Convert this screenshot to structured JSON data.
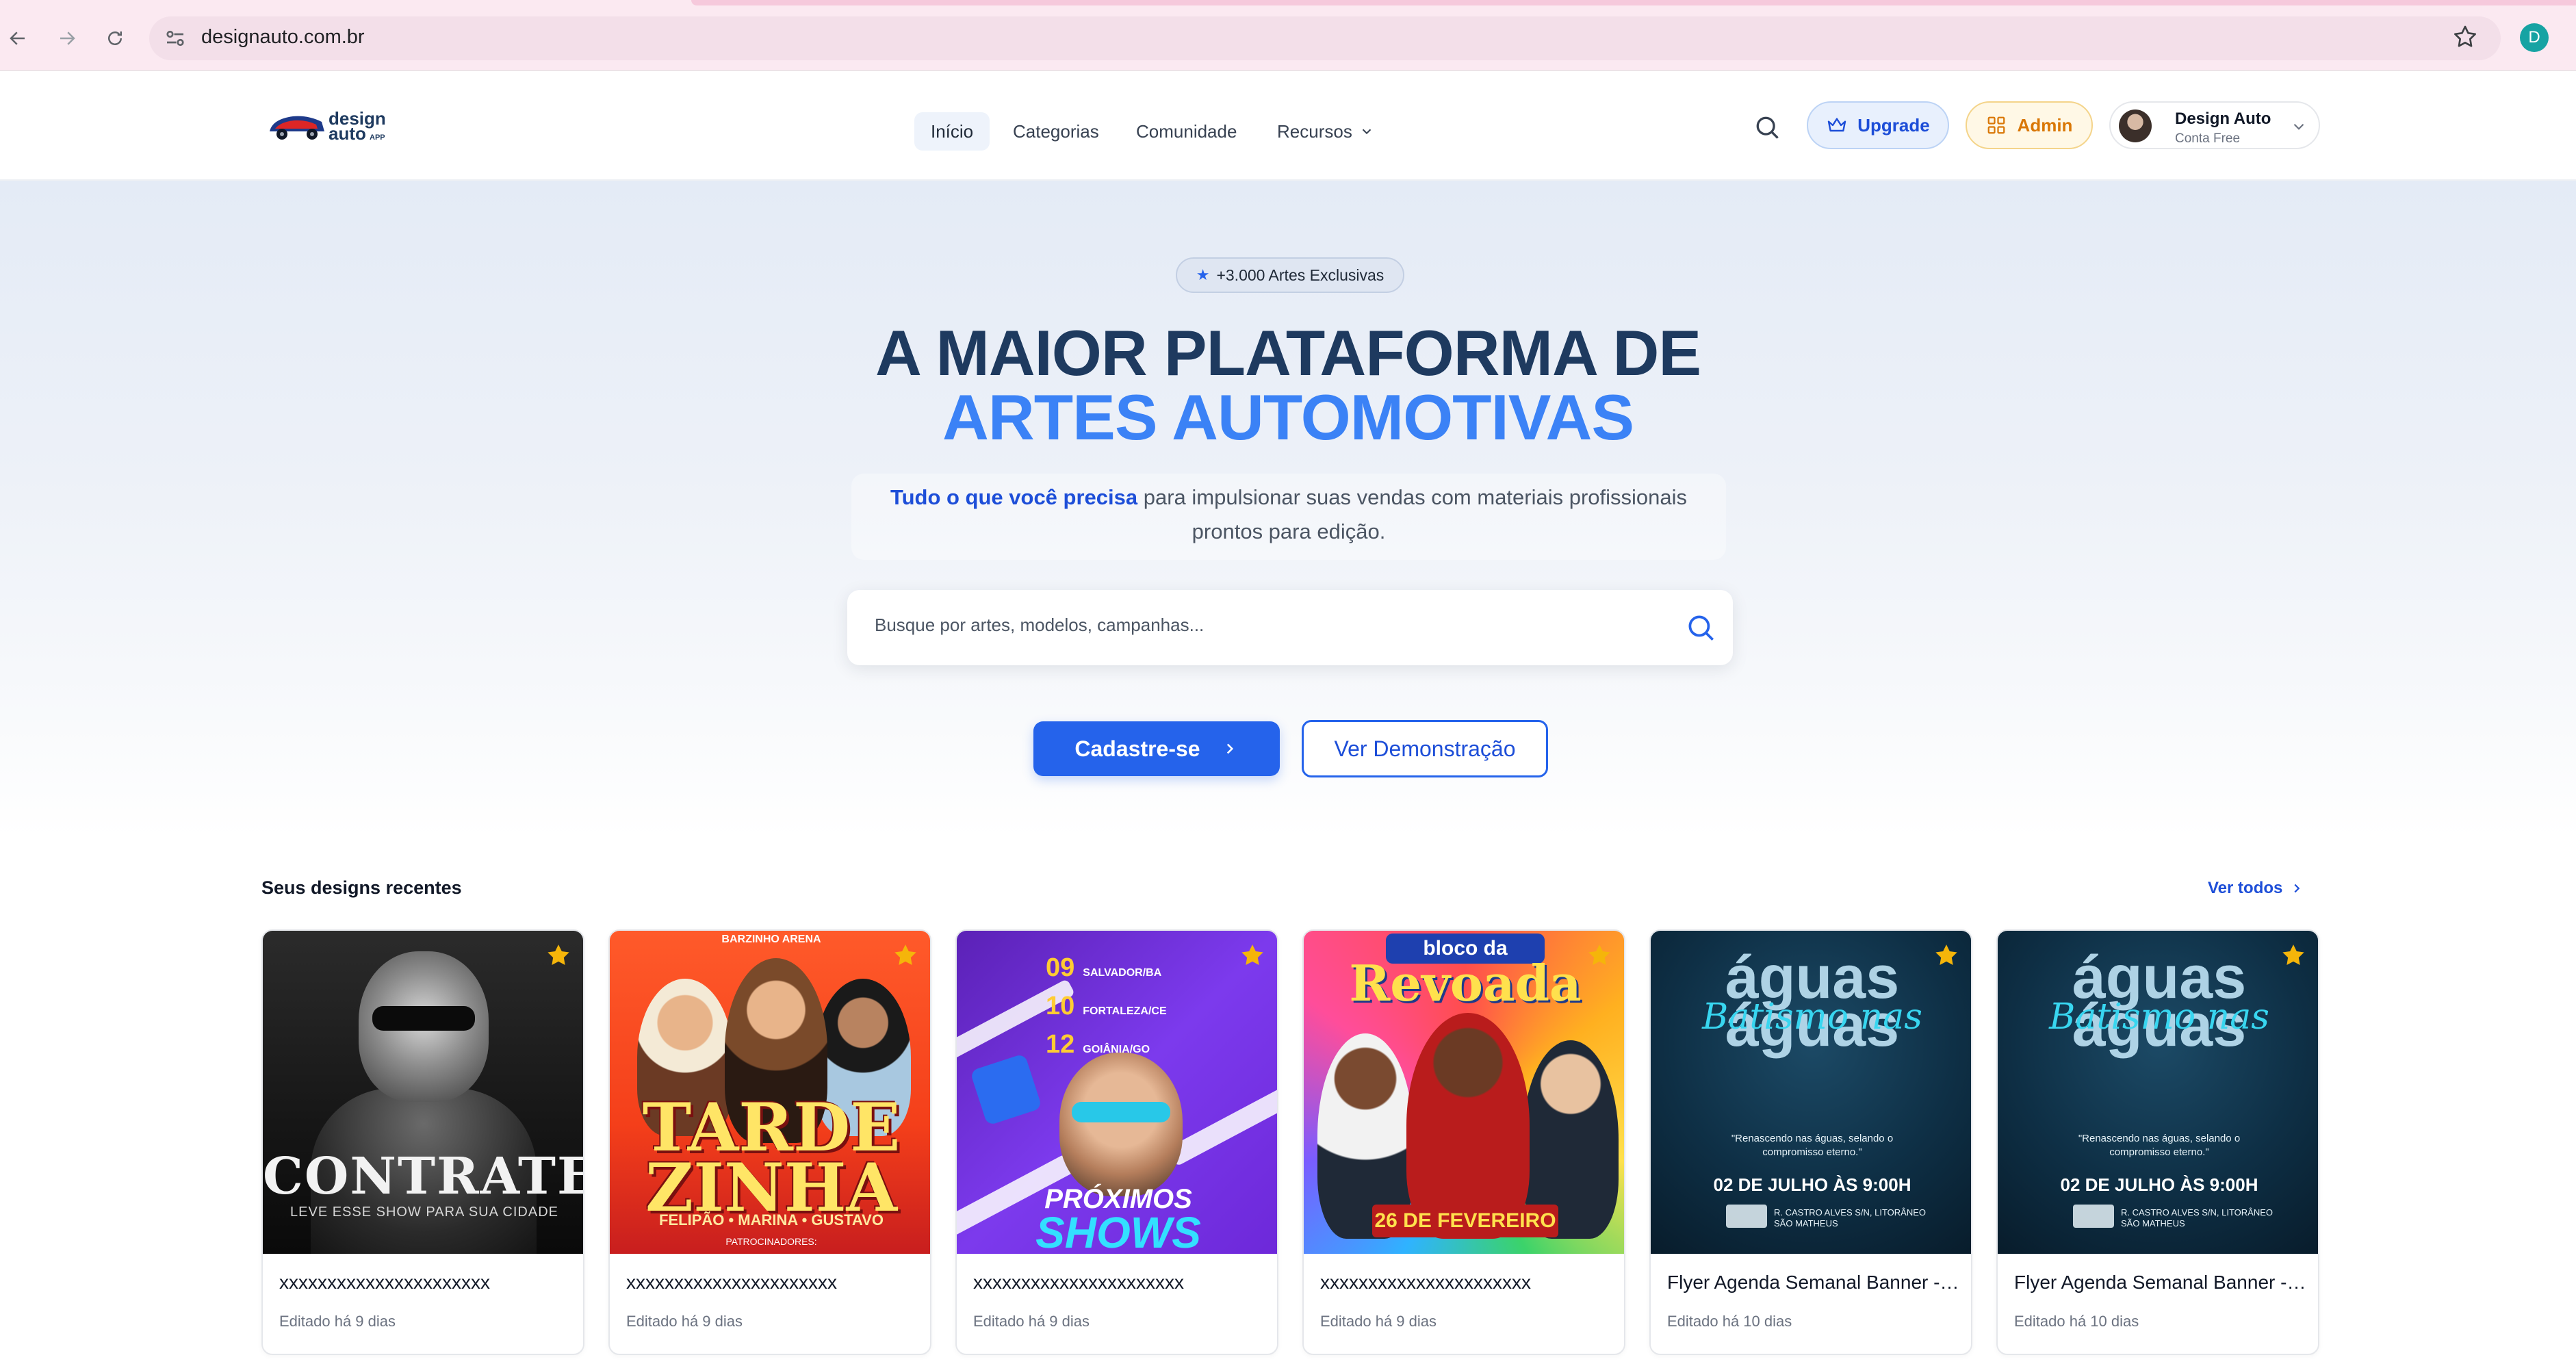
{
  "browser": {
    "url": "designauto.com.br",
    "profile_initial": "D"
  },
  "header": {
    "logo_text": "design auto APP",
    "nav": [
      "Início",
      "Categorias",
      "Comunidade",
      "Recursos"
    ],
    "upgrade_label": "Upgrade",
    "admin_label": "Admin",
    "account": {
      "name": "Design Auto",
      "plan": "Conta Free"
    }
  },
  "hero": {
    "badge": "+3.000 Artes Exclusivas",
    "title_line1": "A MAIOR PLATAFORMA DE",
    "title_line2": "ARTES AUTOMOTIVAS",
    "subtitle_highlight": "Tudo o que você precisa",
    "subtitle_rest": " para impulsionar suas vendas com materiais profissionais",
    "subtitle_line2": "prontos para edição.",
    "search_placeholder": "Busque por artes, modelos, campanhas...",
    "cta_primary": "Cadastre-se",
    "cta_secondary": "Ver Demonstração"
  },
  "recent": {
    "title": "Seus designs recentes",
    "view_all": "Ver todos",
    "cards": [
      {
        "title": "xxxxxxxxxxxxxxxxxxxxxx",
        "edited": "Editado há 9 dias",
        "art_text": "CONTRATE",
        "art_sub": "LEVE ESSE SHOW PARA SUA CIDADE"
      },
      {
        "title": "xxxxxxxxxxxxxxxxxxxxxx",
        "edited": "Editado há 9 dias",
        "art_top": "BARZINHO ARENA",
        "art_text": "TARDE ZINHA",
        "art_sub": "FELIPÃO • MARINA • GUSTAVO",
        "art_foot": "PATROCINADORES:"
      },
      {
        "title": "xxxxxxxxxxxxxxxxxxxxxx",
        "edited": "Editado há 9 dias",
        "dates": [
          {
            "day": "09",
            "city": "SALVADOR/BA"
          },
          {
            "day": "10",
            "city": "FORTALEZA/CE"
          },
          {
            "day": "12",
            "city": "GOIÂNIA/GO"
          }
        ],
        "art_text": "PRÓXIMOS",
        "art_sub": "SHOWS"
      },
      {
        "title": "xxxxxxxxxxxxxxxxxxxxxx",
        "edited": "Editado há 9 dias",
        "art_top": "bloco da",
        "art_text": "Revoada",
        "art_sub": "26 DE FEVEREIRO"
      },
      {
        "title": "Flyer Agenda Semanal Banner - Dia Nacional do Turismo",
        "edited": "Editado há 10 dias",
        "art_text": "águas",
        "art_script": "Batismo nas",
        "art_quote": "\"Renascendo nas águas, selando o compromisso eterno.\"",
        "art_sub": "02 DE JULHO ÀS 9:00H",
        "art_addr": "R. CASTRO ALVES S/N, LITORÂNEO SÃO MATHEUS"
      },
      {
        "title": "Flyer Agenda Semanal Banner - Dia Nacional do Turismo",
        "edited": "Editado há 10 dias",
        "art_text": "águas",
        "art_script": "Batismo nas",
        "art_quote": "\"Renascendo nas águas, selando o compromisso eterno.\"",
        "art_sub": "02 DE JULHO ÀS 9:00H",
        "art_addr": "R. CASTRO ALVES S/N, LITORÂNEO SÃO MATHEUS"
      }
    ]
  },
  "colors": {
    "brand_blue": "#2563eb",
    "title_dark": "#1e3a5f",
    "title_accent": "#3b82f6",
    "admin_amber": "#d97706",
    "fav_star": "#f5b50a"
  }
}
